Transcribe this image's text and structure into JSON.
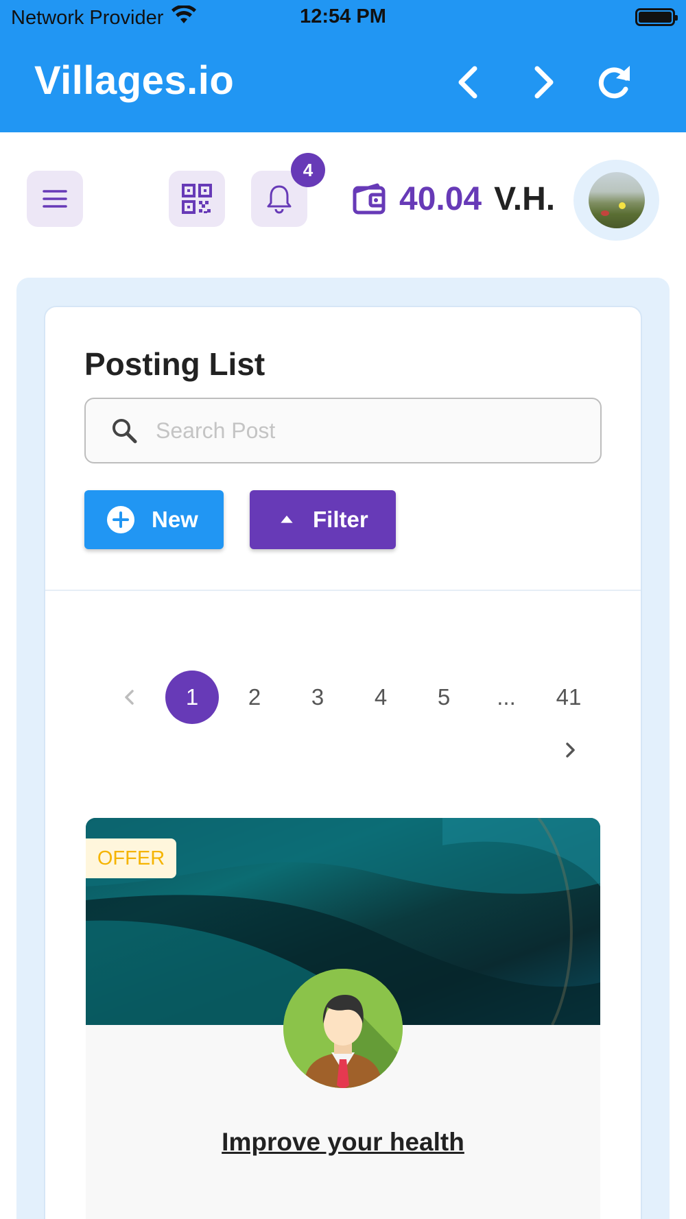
{
  "status_bar": {
    "carrier": "Network Provider",
    "time": "12:54 PM",
    "wifi_icon": "wifi-icon",
    "battery_icon": "battery-icon"
  },
  "app_bar": {
    "title": "Villages.io",
    "back_icon": "chevron-left-icon",
    "forward_icon": "chevron-right-icon",
    "reload_icon": "refresh-icon",
    "background_color": "#2196f3"
  },
  "toolbar": {
    "menu_icon": "hamburger-menu-icon",
    "qr_icon": "qr-code-icon",
    "bell_icon": "bell-icon",
    "notification_count": "4",
    "wallet_icon": "wallet-icon",
    "balance": "40.04",
    "balance_unit": "V.H.",
    "accent_color": "#673ab7"
  },
  "posting": {
    "title": "Posting List",
    "search_placeholder": "Search Post",
    "search_value": "",
    "new_label": "New",
    "filter_label": "Filter"
  },
  "pagination": {
    "pages": [
      "1",
      "2",
      "3",
      "4",
      "5",
      "...",
      "41"
    ],
    "current": "1"
  },
  "post": {
    "tag": "OFFER",
    "title": "Improve your health",
    "subtitle": "",
    "tag_color": "#f5b400"
  }
}
